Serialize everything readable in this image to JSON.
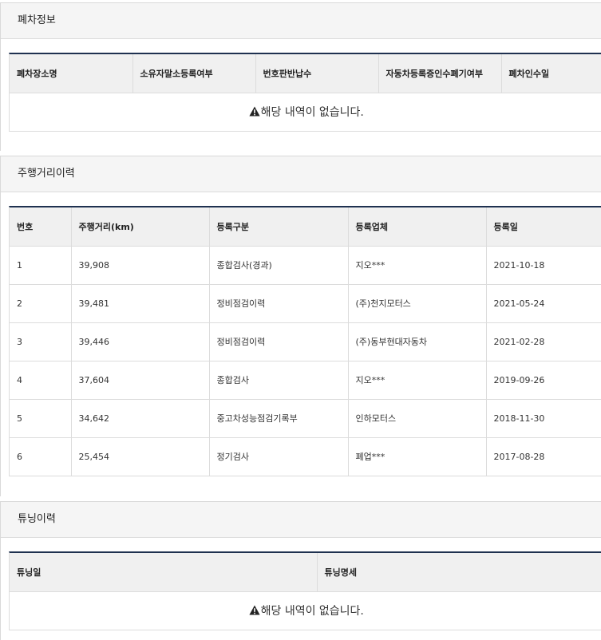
{
  "scrap": {
    "title": "폐차정보",
    "headers": [
      "폐차장소명",
      "소유자말소등록여부",
      "번호판반납수",
      "자동차등록증인수폐기여부",
      "폐차인수일"
    ],
    "empty_message": "해당 내역이 없습니다."
  },
  "mileage": {
    "title": "주행거리이력",
    "headers": [
      "번호",
      "주행거리(km)",
      "등록구분",
      "등록업체",
      "등록일"
    ],
    "rows": [
      [
        "1",
        "39,908",
        "종합검사(경과)",
        "지오***",
        "2021-10-18"
      ],
      [
        "2",
        "39,481",
        "정비점검이력",
        "(주)천지모터스",
        "2021-05-24"
      ],
      [
        "3",
        "39,446",
        "정비점검이력",
        "(주)동부현대자동차",
        "2021-02-28"
      ],
      [
        "4",
        "37,604",
        "종합검사",
        "지오***",
        "2019-09-26"
      ],
      [
        "5",
        "34,642",
        "중고차성능점검기록부",
        "인하모터스",
        "2018-11-30"
      ],
      [
        "6",
        "25,454",
        "정기검사",
        "폐업***",
        "2017-08-28"
      ]
    ]
  },
  "tuning": {
    "title": "튜닝이력",
    "headers": [
      "튜닝일",
      "튜닝명세"
    ],
    "empty_message": "해당 내역이 없습니다."
  },
  "icons": {
    "warning": "warning-triangle-icon"
  }
}
